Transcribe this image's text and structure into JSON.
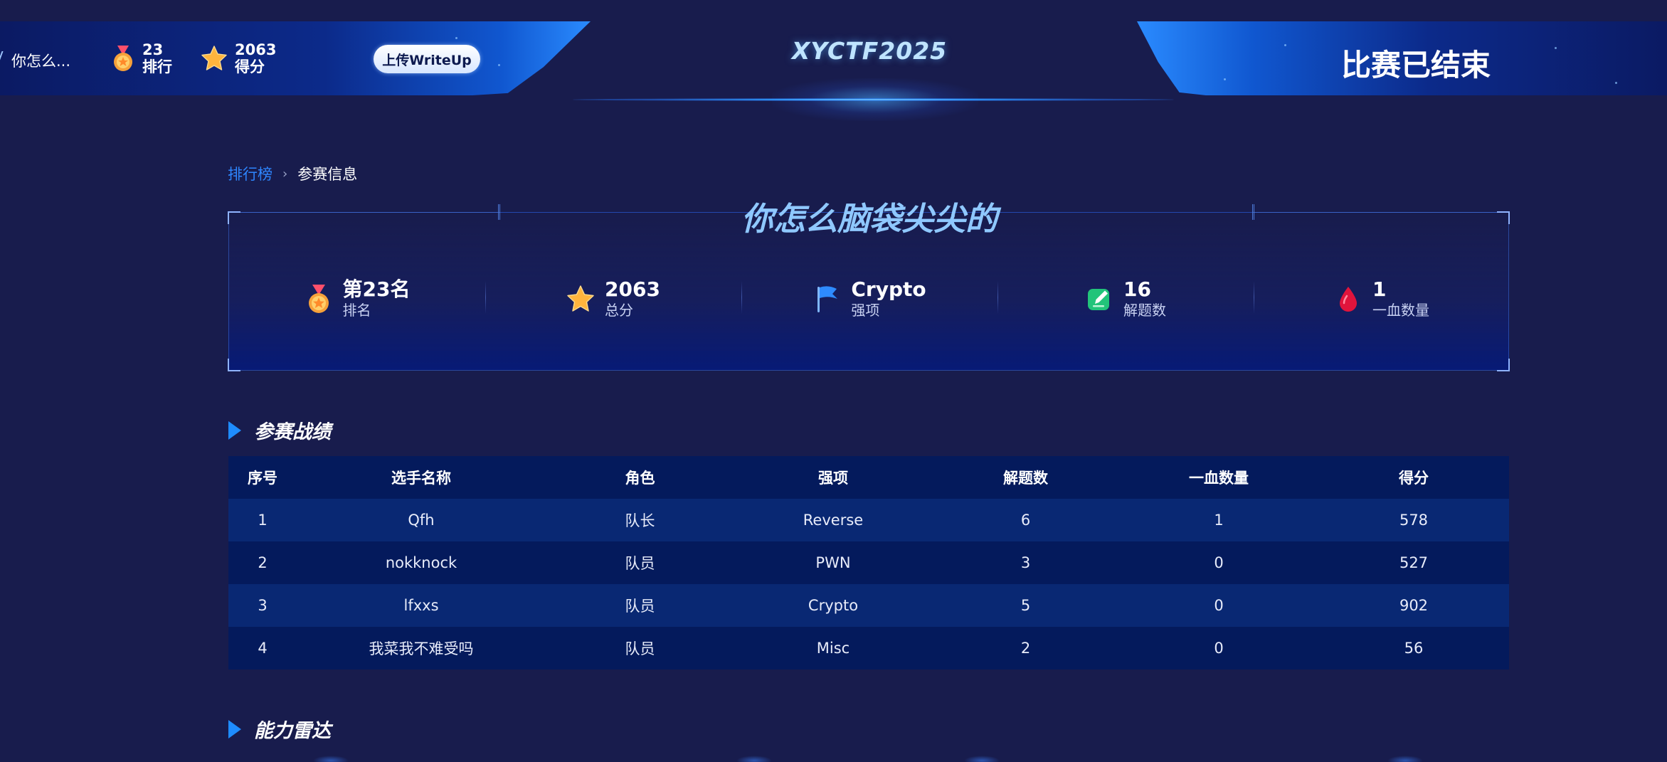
{
  "header": {
    "team_short": "你怎么...",
    "rank_value": "23",
    "rank_label": "排行",
    "score_value": "2063",
    "score_label": "得分",
    "upload_label": "上传WriteUp",
    "ctf_title": "XYCTF2025",
    "status": "比赛已结束"
  },
  "breadcrumb": {
    "root": "排行榜",
    "current": "参赛信息"
  },
  "team": {
    "name": "你怎么脑袋尖尖的",
    "stats": [
      {
        "value": "第23名",
        "label": "排名",
        "icon": "medal-icon"
      },
      {
        "value": "2063",
        "label": "总分",
        "icon": "star-icon"
      },
      {
        "value": "Crypto",
        "label": "强项",
        "icon": "flag-icon"
      },
      {
        "value": "16",
        "label": "解题数",
        "icon": "edit-icon"
      },
      {
        "value": "1",
        "label": "一血数量",
        "icon": "blood-drop-icon"
      }
    ]
  },
  "sections": {
    "record": "参赛战绩",
    "radar": "能力雷达"
  },
  "table": {
    "columns": [
      "序号",
      "选手名称",
      "角色",
      "强项",
      "解题数",
      "一血数量",
      "得分"
    ],
    "rows": [
      [
        "1",
        "Qfh",
        "队长",
        "Reverse",
        "6",
        "1",
        "578"
      ],
      [
        "2",
        "nokknock",
        "队员",
        "PWN",
        "3",
        "0",
        "527"
      ],
      [
        "3",
        "lfxxs",
        "队员",
        "Crypto",
        "5",
        "0",
        "902"
      ],
      [
        "4",
        "我菜我不难受吗",
        "队员",
        "Misc",
        "2",
        "0",
        "56"
      ]
    ]
  },
  "colors": {
    "background": "#181c4d",
    "accent": "#1e8cff",
    "link": "#2e86ff",
    "title": "#8fc8ff"
  }
}
